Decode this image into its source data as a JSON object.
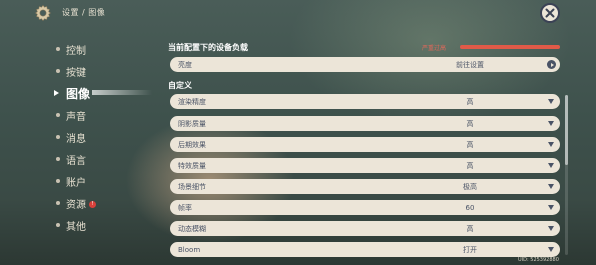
{
  "header": {
    "breadcrumb": "设置 / 图像"
  },
  "sidebar": {
    "items": [
      {
        "label": "控制",
        "active": false
      },
      {
        "label": "按键",
        "active": false
      },
      {
        "label": "图像",
        "active": true
      },
      {
        "label": "声音",
        "active": false
      },
      {
        "label": "消息",
        "active": false
      },
      {
        "label": "语言",
        "active": false
      },
      {
        "label": "账户",
        "active": false
      },
      {
        "label": "资源",
        "active": false,
        "badge": "!"
      },
      {
        "label": "其他",
        "active": false
      }
    ]
  },
  "device_load": {
    "title": "当前配置下的设备负载",
    "status": "严重过高",
    "color": "#e05a48",
    "brightness": {
      "label": "亮度",
      "value": "前往设置"
    }
  },
  "custom": {
    "title": "自定义",
    "rows": [
      {
        "label": "渲染精度",
        "value": "高"
      },
      {
        "label": "阴影质量",
        "value": "高"
      },
      {
        "label": "后期效果",
        "value": "高"
      },
      {
        "label": "特效质量",
        "value": "高"
      },
      {
        "label": "场景细节",
        "value": "极高"
      },
      {
        "label": "帧率",
        "value": "60"
      },
      {
        "label": "动态模糊",
        "value": "高"
      },
      {
        "label": "Bloom",
        "value": "打开"
      }
    ]
  },
  "footer": {
    "uid": "UID: 525392880"
  },
  "colors": {
    "row_bg": "#ece5d8",
    "row_text": "#4a5366",
    "accent_red": "#e05a48"
  }
}
